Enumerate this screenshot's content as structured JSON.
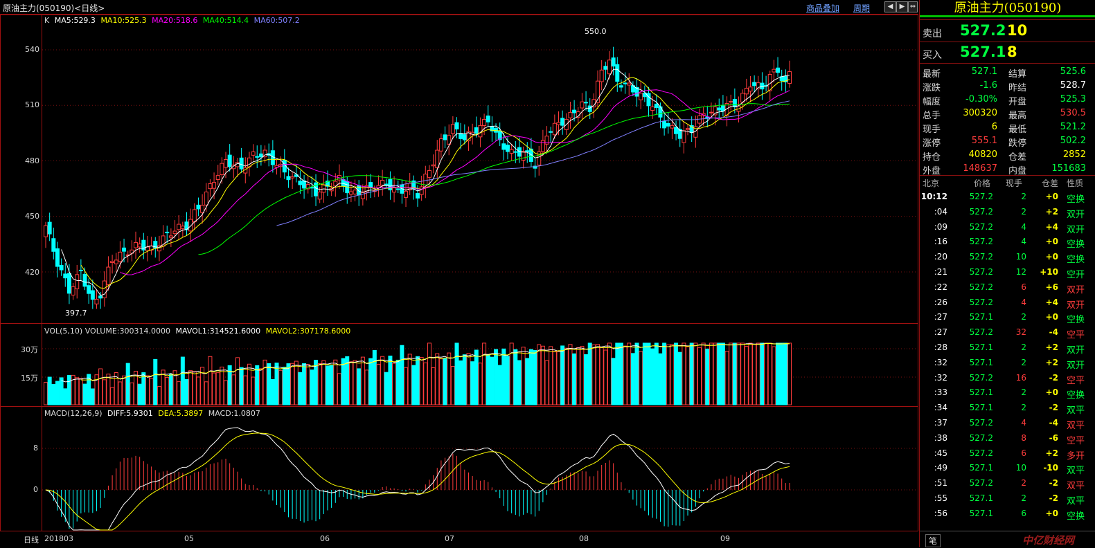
{
  "window": {
    "title": "原油主力(050190)<日线>",
    "overlay_link": "商品叠加",
    "period_link": "周期",
    "nav_buttons": [
      "◀",
      "▶",
      "⇔"
    ]
  },
  "kline": {
    "header_prefix": "K",
    "ma5": "MA5:529.3",
    "ma10": "MA10:525.3",
    "ma20": "MA20:518.6",
    "ma40": "MA40:514.4",
    "ma60": "MA60:507.2",
    "y_ticks": [
      "540",
      "510",
      "480",
      "450",
      "420"
    ],
    "max_label": "550.0",
    "min_label": "397.7",
    "colors": {
      "ma5": "#ffffff",
      "ma10": "#ffff00",
      "ma20": "#ff00ff",
      "ma40": "#00ff00",
      "ma60": "#8080ff",
      "up": "#ff3c3c",
      "down": "#00ffff"
    }
  },
  "volume": {
    "header_label": "VOL(5,10)",
    "volume": "VOLUME:300314.0000",
    "mavol1": "MAVOL1:314521.6000",
    "mavol2": "MAVOL2:307178.6000",
    "y_ticks": [
      "30万",
      "15万"
    ]
  },
  "macd": {
    "header_label": "MACD(12,26,9)",
    "diff": "DIFF:5.9301",
    "dea": "DEA:5.3897",
    "macd": "MACD:1.0807",
    "y_ticks": [
      "8",
      "0"
    ]
  },
  "x_axis": {
    "period_button": "日线",
    "labels": [
      "201803",
      "05",
      "06",
      "07",
      "08",
      "09"
    ]
  },
  "quote": {
    "title": "原油主力(050190)",
    "ask_label": "卖出",
    "ask_price": "527.2",
    "ask_volume": "10",
    "bid_label": "买入",
    "bid_price": "527.1",
    "bid_volume": "8",
    "stats": [
      {
        "l1": "最新",
        "v1": "527.1",
        "c1": "grn",
        "l2": "结算",
        "v2": "525.6",
        "c2": "grn"
      },
      {
        "l1": "涨跌",
        "v1": "-1.6",
        "c1": "grn",
        "l2": "昨结",
        "v2": "528.7",
        "c2": "wht"
      },
      {
        "l1": "幅度",
        "v1": "-0.30%",
        "c1": "grn",
        "l2": "开盘",
        "v2": "525.3",
        "c2": "grn"
      },
      {
        "l1": "总手",
        "v1": "300320",
        "c1": "yel",
        "l2": "最高",
        "v2": "530.5",
        "c2": "red"
      },
      {
        "l1": "现手",
        "v1": "6",
        "c1": "yel",
        "l2": "最低",
        "v2": "521.2",
        "c2": "grn"
      },
      {
        "l1": "涨停",
        "v1": "555.1",
        "c1": "red",
        "l2": "跌停",
        "v2": "502.2",
        "c2": "grn"
      },
      {
        "l1": "持仓",
        "v1": "40820",
        "c1": "yel",
        "l2": "仓差",
        "v2": "2852",
        "c2": "yel"
      },
      {
        "l1": "外盘",
        "v1": "148637",
        "c1": "red",
        "l2": "内盘",
        "v2": "151683",
        "c2": "grn"
      }
    ],
    "tick_headers": [
      "北京",
      "价格",
      "现手",
      "仓差",
      "性质"
    ],
    "ticks": [
      {
        "t": "10:12",
        "p": "527.2",
        "v": "2",
        "d": "+0",
        "n": "空换",
        "vc": "grn",
        "dc": "yel",
        "nc": "grn"
      },
      {
        "t": ":04",
        "p": "527.2",
        "v": "2",
        "d": "+2",
        "n": "双开",
        "vc": "grn",
        "dc": "yel",
        "nc": "grn"
      },
      {
        "t": ":09",
        "p": "527.2",
        "v": "4",
        "d": "+4",
        "n": "双开",
        "vc": "grn",
        "dc": "yel",
        "nc": "grn"
      },
      {
        "t": ":16",
        "p": "527.2",
        "v": "4",
        "d": "+0",
        "n": "空换",
        "vc": "grn",
        "dc": "yel",
        "nc": "grn"
      },
      {
        "t": ":20",
        "p": "527.2",
        "v": "10",
        "d": "+0",
        "n": "空换",
        "vc": "grn",
        "dc": "yel",
        "nc": "grn"
      },
      {
        "t": ":21",
        "p": "527.2",
        "v": "12",
        "d": "+10",
        "n": "空开",
        "vc": "grn",
        "dc": "yel",
        "nc": "grn"
      },
      {
        "t": ":22",
        "p": "527.2",
        "v": "6",
        "d": "+6",
        "n": "双开",
        "vc": "red",
        "dc": "yel",
        "nc": "red"
      },
      {
        "t": ":26",
        "p": "527.2",
        "v": "4",
        "d": "+4",
        "n": "双开",
        "vc": "red",
        "dc": "yel",
        "nc": "red"
      },
      {
        "t": ":27",
        "p": "527.1",
        "v": "2",
        "d": "+0",
        "n": "空换",
        "vc": "grn",
        "dc": "yel",
        "nc": "grn"
      },
      {
        "t": ":27",
        "p": "527.2",
        "v": "32",
        "d": "-4",
        "n": "空平",
        "vc": "red",
        "dc": "yel",
        "nc": "red"
      },
      {
        "t": ":28",
        "p": "527.1",
        "v": "2",
        "d": "+2",
        "n": "双开",
        "vc": "grn",
        "dc": "yel",
        "nc": "grn"
      },
      {
        "t": ":32",
        "p": "527.1",
        "v": "2",
        "d": "+2",
        "n": "双开",
        "vc": "grn",
        "dc": "yel",
        "nc": "grn"
      },
      {
        "t": ":32",
        "p": "527.2",
        "v": "16",
        "d": "-2",
        "n": "空平",
        "vc": "red",
        "dc": "yel",
        "nc": "red"
      },
      {
        "t": ":33",
        "p": "527.1",
        "v": "2",
        "d": "+0",
        "n": "空换",
        "vc": "grn",
        "dc": "yel",
        "nc": "grn"
      },
      {
        "t": ":34",
        "p": "527.1",
        "v": "2",
        "d": "-2",
        "n": "双平",
        "vc": "grn",
        "dc": "yel",
        "nc": "grn"
      },
      {
        "t": ":37",
        "p": "527.2",
        "v": "4",
        "d": "-4",
        "n": "双平",
        "vc": "red",
        "dc": "yel",
        "nc": "red"
      },
      {
        "t": ":38",
        "p": "527.2",
        "v": "8",
        "d": "-6",
        "n": "空平",
        "vc": "red",
        "dc": "yel",
        "nc": "red"
      },
      {
        "t": ":45",
        "p": "527.2",
        "v": "6",
        "d": "+2",
        "n": "多开",
        "vc": "red",
        "dc": "yel",
        "nc": "red"
      },
      {
        "t": ":49",
        "p": "527.1",
        "v": "10",
        "d": "-10",
        "n": "双平",
        "vc": "grn",
        "dc": "yel",
        "nc": "grn"
      },
      {
        "t": ":51",
        "p": "527.2",
        "v": "2",
        "d": "-2",
        "n": "双平",
        "vc": "red",
        "dc": "yel",
        "nc": "red"
      },
      {
        "t": ":55",
        "p": "527.1",
        "v": "2",
        "d": "-2",
        "n": "双平",
        "vc": "grn",
        "dc": "yel",
        "nc": "grn"
      },
      {
        "t": ":56",
        "p": "527.1",
        "v": "6",
        "d": "+0",
        "n": "空换",
        "vc": "grn",
        "dc": "yel",
        "nc": "grn"
      }
    ],
    "bottom_tab": "笔",
    "watermark": "中亿财经网"
  }
}
